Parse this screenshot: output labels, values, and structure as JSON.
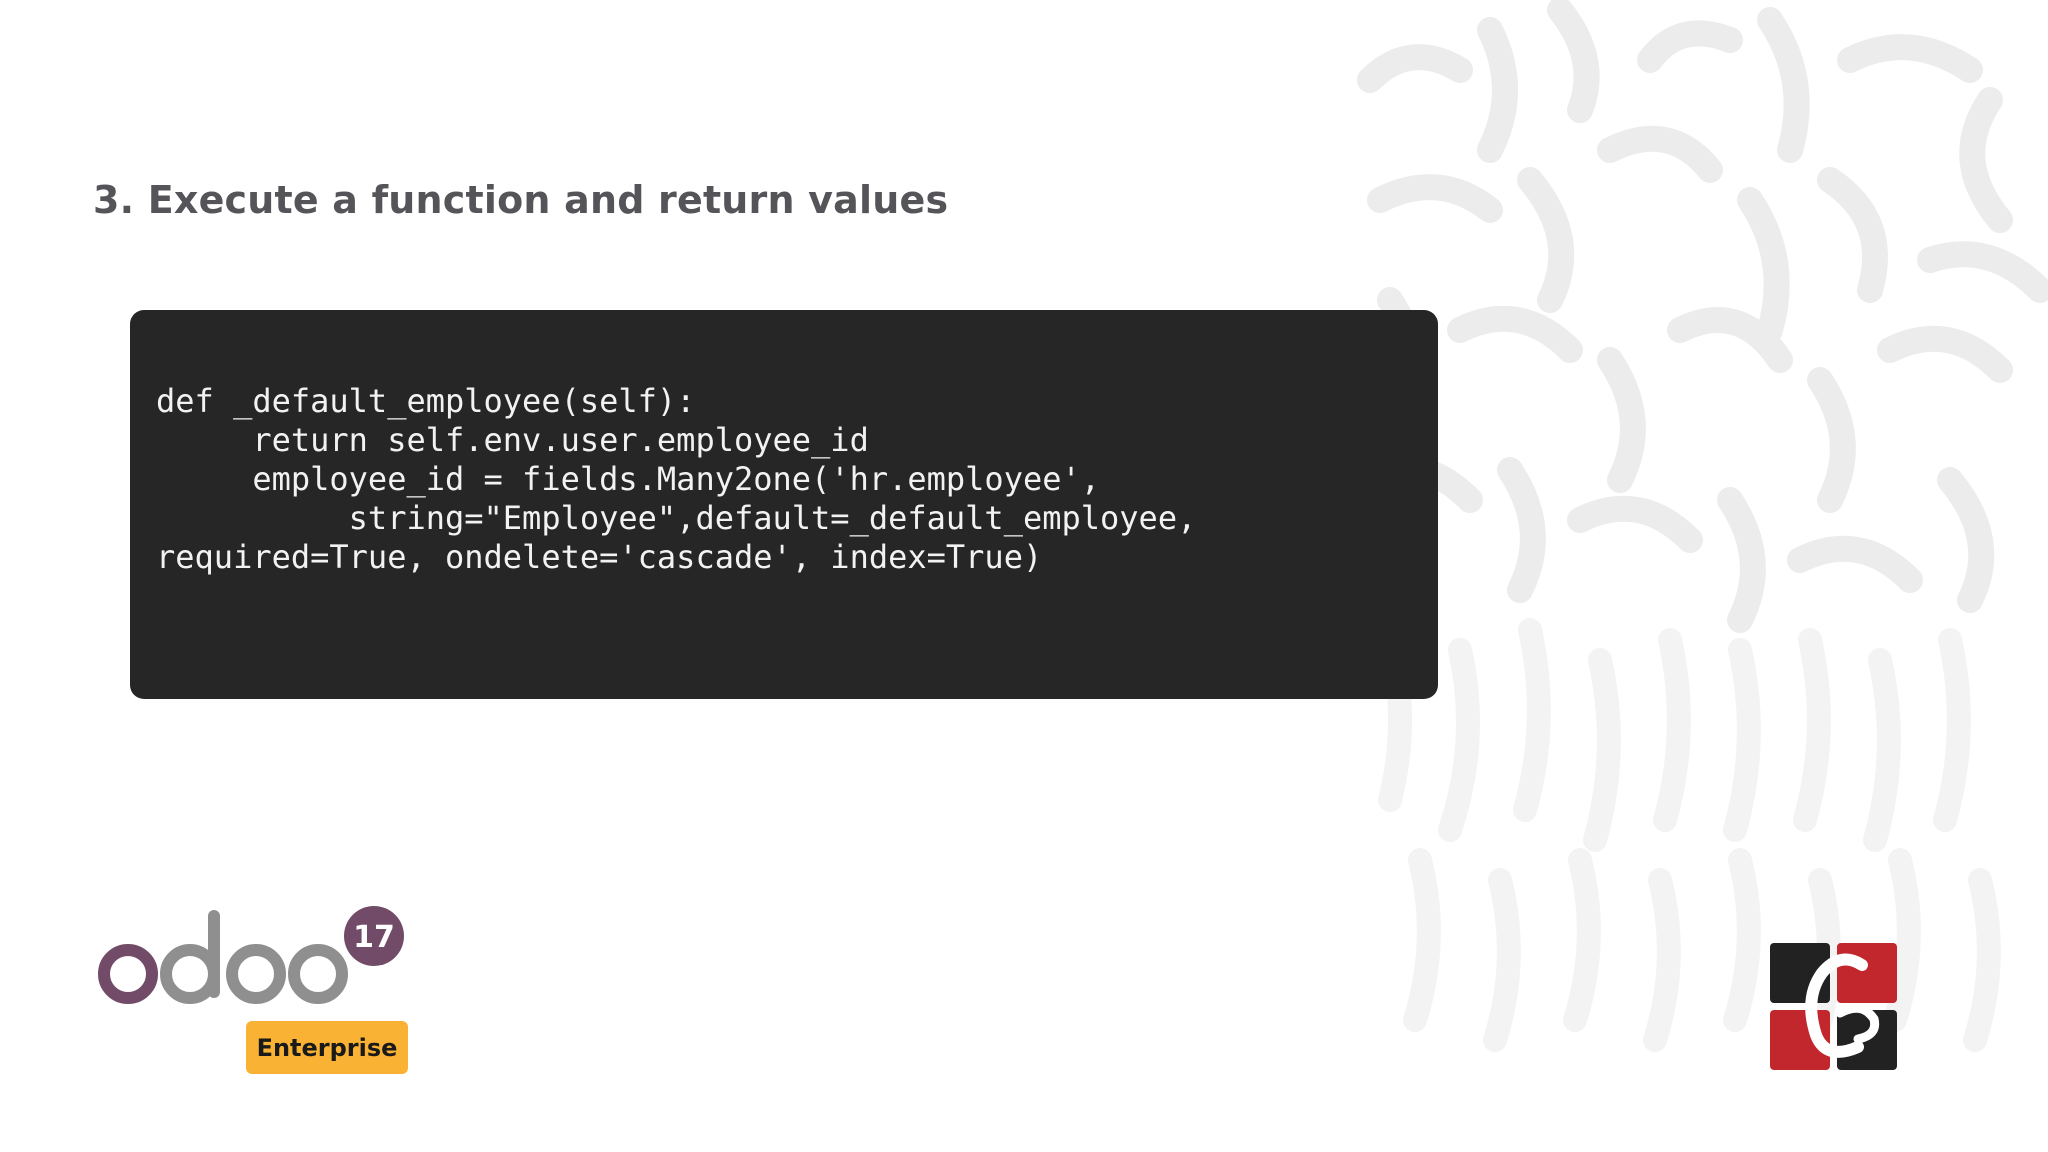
{
  "slide": {
    "title": "3. Execute a function and return values"
  },
  "code": {
    "lines": [
      "",
      "def _default_employee(self):",
      "     return self.env.user.employee_id",
      "",
      "     employee_id = fields.Many2one('hr.employee',",
      "          string=\"Employee\",default=_default_employee,",
      "required=True, ondelete='cascade', index=True)"
    ]
  },
  "footer": {
    "odoo_version": "17",
    "edition_badge": "Enterprise"
  },
  "colors": {
    "title": "#555459",
    "code_background": "#262626",
    "odoo_purple": "#714b67",
    "odoo_gray": "#8f8f8f",
    "badge_yellow": "#f9b233",
    "brand_red": "#c1272d",
    "brand_black": "#222222"
  },
  "icons": {
    "odoo_logo": "odoo-logo",
    "brand_logo": "cybrosys-logo",
    "background": "squiggle-pattern"
  }
}
